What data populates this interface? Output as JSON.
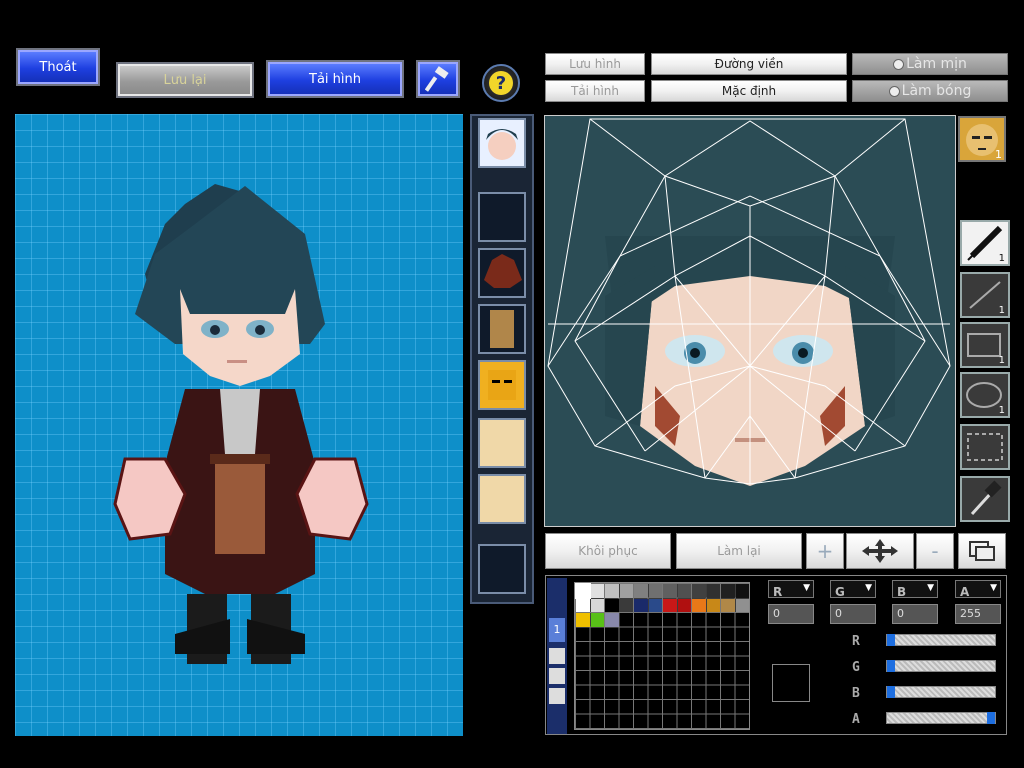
{
  "toolbar": {
    "exit_label": "Thoát",
    "save_label": "Lưu lại",
    "reload_label": "Tải hình",
    "help_glyph": "?"
  },
  "editor_buttons": {
    "save_label": "Lưu hình",
    "reload_label": "Tải hình",
    "outline_label": "Đường viền",
    "default_label": "Mặc định",
    "smooth_label": "Làm mịn",
    "shade_label": "Làm bóng"
  },
  "tools": {
    "pen_count": "1",
    "line_count": "1",
    "rect_count": "1",
    "ellipse_count": "1",
    "face_count": "1"
  },
  "bottom_buttons": {
    "restore_label": "Khôi phục",
    "redo_label": "Làm lại",
    "zoom_in": "+",
    "zoom_out": "-"
  },
  "palette": {
    "layer_label": "1",
    "colors": [
      "#ffffff",
      "#e0e0e0",
      "#c0c0c0",
      "#a0a0a0",
      "#808080",
      "#707070",
      "#606060",
      "#505050",
      "#404040",
      "#303030",
      "#202020",
      "#101010",
      "#ffffff",
      "#d8d8d8",
      "#000000",
      "#3a3a3a",
      "#1a2a6a",
      "#2a4a8a",
      "#c81818",
      "#b01010",
      "#e87818",
      "#c88818",
      "#b08848",
      "#909090",
      "#f0c000",
      "#58c018",
      "#8888aa"
    ],
    "selected_color": "#000000"
  },
  "channels": {
    "r_label": "R",
    "g_label": "G",
    "b_label": "B",
    "a_label": "A",
    "r_value": "0",
    "g_value": "0",
    "b_value": "0",
    "a_value": "255",
    "r_level": 0,
    "g_level": 0,
    "b_level": 0,
    "a_level": 1.0
  }
}
